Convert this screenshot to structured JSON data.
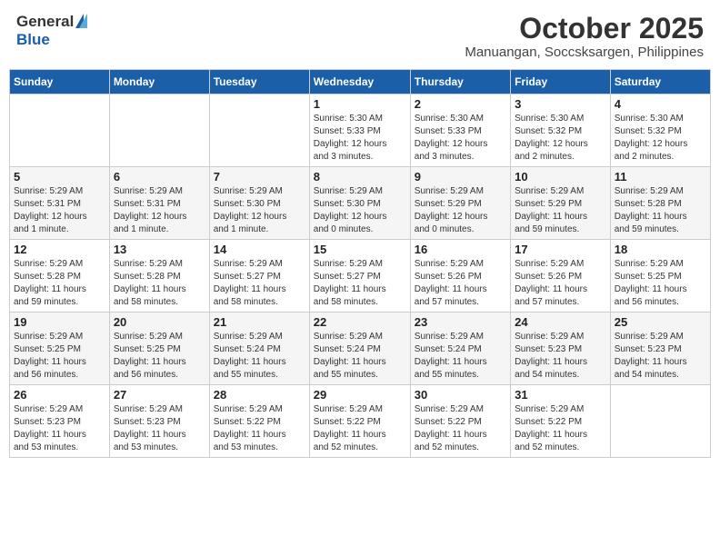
{
  "header": {
    "logo_general": "General",
    "logo_blue": "Blue",
    "month": "October 2025",
    "location": "Manuangan, Soccsksargen, Philippines"
  },
  "weekdays": [
    "Sunday",
    "Monday",
    "Tuesday",
    "Wednesday",
    "Thursday",
    "Friday",
    "Saturday"
  ],
  "weeks": [
    [
      {
        "day": "",
        "info": ""
      },
      {
        "day": "",
        "info": ""
      },
      {
        "day": "",
        "info": ""
      },
      {
        "day": "1",
        "info": "Sunrise: 5:30 AM\nSunset: 5:33 PM\nDaylight: 12 hours\nand 3 minutes."
      },
      {
        "day": "2",
        "info": "Sunrise: 5:30 AM\nSunset: 5:33 PM\nDaylight: 12 hours\nand 3 minutes."
      },
      {
        "day": "3",
        "info": "Sunrise: 5:30 AM\nSunset: 5:32 PM\nDaylight: 12 hours\nand 2 minutes."
      },
      {
        "day": "4",
        "info": "Sunrise: 5:30 AM\nSunset: 5:32 PM\nDaylight: 12 hours\nand 2 minutes."
      }
    ],
    [
      {
        "day": "5",
        "info": "Sunrise: 5:29 AM\nSunset: 5:31 PM\nDaylight: 12 hours\nand 1 minute."
      },
      {
        "day": "6",
        "info": "Sunrise: 5:29 AM\nSunset: 5:31 PM\nDaylight: 12 hours\nand 1 minute."
      },
      {
        "day": "7",
        "info": "Sunrise: 5:29 AM\nSunset: 5:30 PM\nDaylight: 12 hours\nand 1 minute."
      },
      {
        "day": "8",
        "info": "Sunrise: 5:29 AM\nSunset: 5:30 PM\nDaylight: 12 hours\nand 0 minutes."
      },
      {
        "day": "9",
        "info": "Sunrise: 5:29 AM\nSunset: 5:29 PM\nDaylight: 12 hours\nand 0 minutes."
      },
      {
        "day": "10",
        "info": "Sunrise: 5:29 AM\nSunset: 5:29 PM\nDaylight: 11 hours\nand 59 minutes."
      },
      {
        "day": "11",
        "info": "Sunrise: 5:29 AM\nSunset: 5:28 PM\nDaylight: 11 hours\nand 59 minutes."
      }
    ],
    [
      {
        "day": "12",
        "info": "Sunrise: 5:29 AM\nSunset: 5:28 PM\nDaylight: 11 hours\nand 59 minutes."
      },
      {
        "day": "13",
        "info": "Sunrise: 5:29 AM\nSunset: 5:28 PM\nDaylight: 11 hours\nand 58 minutes."
      },
      {
        "day": "14",
        "info": "Sunrise: 5:29 AM\nSunset: 5:27 PM\nDaylight: 11 hours\nand 58 minutes."
      },
      {
        "day": "15",
        "info": "Sunrise: 5:29 AM\nSunset: 5:27 PM\nDaylight: 11 hours\nand 58 minutes."
      },
      {
        "day": "16",
        "info": "Sunrise: 5:29 AM\nSunset: 5:26 PM\nDaylight: 11 hours\nand 57 minutes."
      },
      {
        "day": "17",
        "info": "Sunrise: 5:29 AM\nSunset: 5:26 PM\nDaylight: 11 hours\nand 57 minutes."
      },
      {
        "day": "18",
        "info": "Sunrise: 5:29 AM\nSunset: 5:25 PM\nDaylight: 11 hours\nand 56 minutes."
      }
    ],
    [
      {
        "day": "19",
        "info": "Sunrise: 5:29 AM\nSunset: 5:25 PM\nDaylight: 11 hours\nand 56 minutes."
      },
      {
        "day": "20",
        "info": "Sunrise: 5:29 AM\nSunset: 5:25 PM\nDaylight: 11 hours\nand 56 minutes."
      },
      {
        "day": "21",
        "info": "Sunrise: 5:29 AM\nSunset: 5:24 PM\nDaylight: 11 hours\nand 55 minutes."
      },
      {
        "day": "22",
        "info": "Sunrise: 5:29 AM\nSunset: 5:24 PM\nDaylight: 11 hours\nand 55 minutes."
      },
      {
        "day": "23",
        "info": "Sunrise: 5:29 AM\nSunset: 5:24 PM\nDaylight: 11 hours\nand 55 minutes."
      },
      {
        "day": "24",
        "info": "Sunrise: 5:29 AM\nSunset: 5:23 PM\nDaylight: 11 hours\nand 54 minutes."
      },
      {
        "day": "25",
        "info": "Sunrise: 5:29 AM\nSunset: 5:23 PM\nDaylight: 11 hours\nand 54 minutes."
      }
    ],
    [
      {
        "day": "26",
        "info": "Sunrise: 5:29 AM\nSunset: 5:23 PM\nDaylight: 11 hours\nand 53 minutes."
      },
      {
        "day": "27",
        "info": "Sunrise: 5:29 AM\nSunset: 5:23 PM\nDaylight: 11 hours\nand 53 minutes."
      },
      {
        "day": "28",
        "info": "Sunrise: 5:29 AM\nSunset: 5:22 PM\nDaylight: 11 hours\nand 53 minutes."
      },
      {
        "day": "29",
        "info": "Sunrise: 5:29 AM\nSunset: 5:22 PM\nDaylight: 11 hours\nand 52 minutes."
      },
      {
        "day": "30",
        "info": "Sunrise: 5:29 AM\nSunset: 5:22 PM\nDaylight: 11 hours\nand 52 minutes."
      },
      {
        "day": "31",
        "info": "Sunrise: 5:29 AM\nSunset: 5:22 PM\nDaylight: 11 hours\nand 52 minutes."
      },
      {
        "day": "",
        "info": ""
      }
    ]
  ]
}
